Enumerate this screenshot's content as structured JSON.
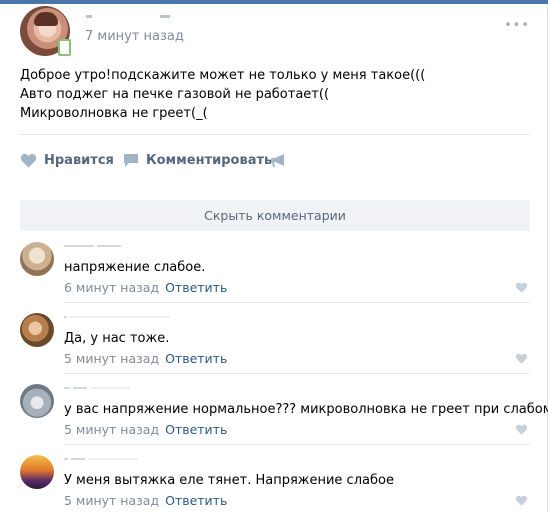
{
  "post": {
    "time": "7 минут назад",
    "text_lines": [
      "Доброе утро!подскажите может не только у меня такое(((",
      "Авто поджег на печке газовой не работает((",
      "Микроволновка не греет(_("
    ]
  },
  "actions": {
    "like": "Нравится",
    "comment": "Комментировать"
  },
  "hide_comments": "Скрыть комментарии",
  "comments": [
    {
      "text": "напряжение слабое.",
      "time": "6 минут назад",
      "reply": "Ответить"
    },
    {
      "text": "Да, у нас тоже.",
      "time": "5 минут назад",
      "reply": "Ответить"
    },
    {
      "text": "у вас напряжение нормальное??? микроволновка не греет при слабом",
      "time": "5 минут назад",
      "reply": "Ответить"
    },
    {
      "text": "У меня вытяжка еле тянет. Напряжение слабое",
      "time": "5 минут назад",
      "reply": "Ответить"
    }
  ],
  "colors": {
    "accent": "#4a76a8",
    "link": "#2a5885",
    "meta": "#828a99",
    "action": "#55677d",
    "button_bg": "#f0f2f5",
    "online": "#8ac176"
  },
  "icons": {
    "like": "heart-icon",
    "comment": "speech-bubble-icon",
    "share": "megaphone-icon",
    "more": "more-dots-icon",
    "online_mobile": "phone-icon"
  }
}
